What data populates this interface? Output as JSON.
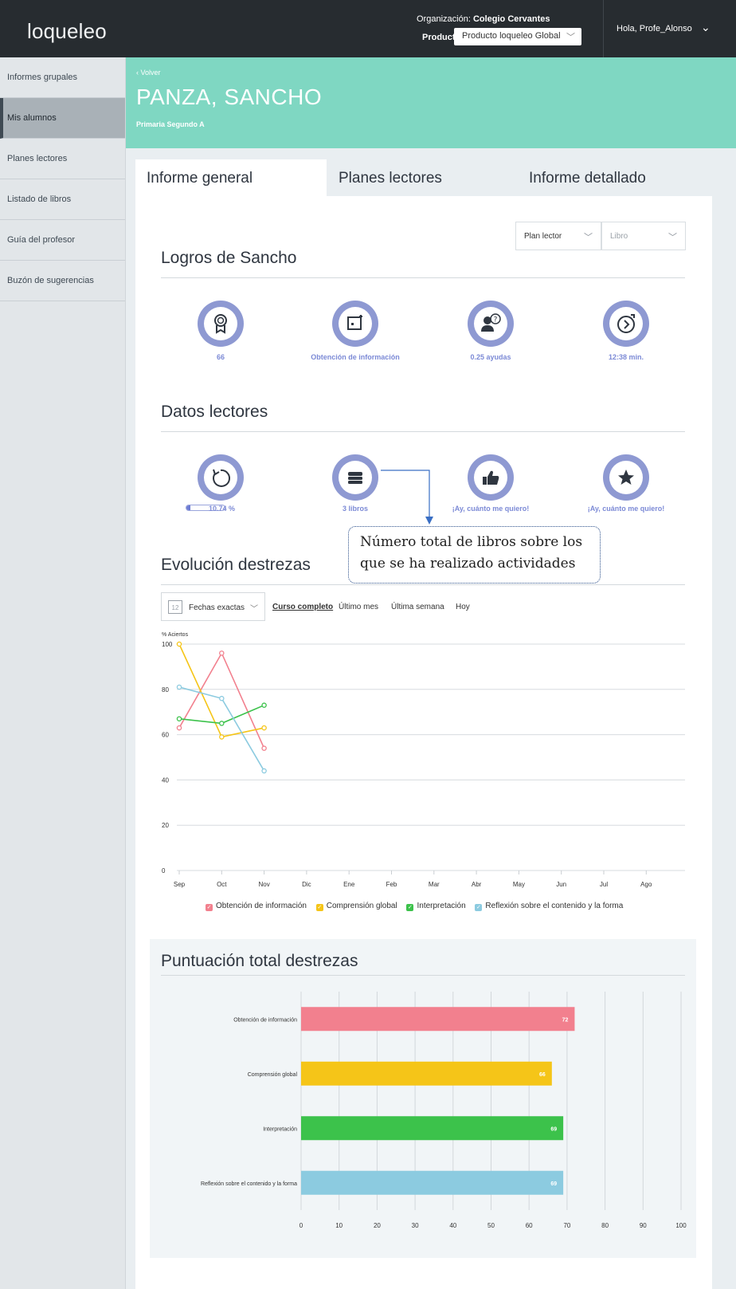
{
  "header": {
    "logo": "loqueleo",
    "org_label": "Organización:",
    "org_value": "Colegio Cervantes",
    "product_label": "Producto:",
    "product_value": "Producto loqueleo Global",
    "greeting": "Hola, Profe_Alonso"
  },
  "sidebar": {
    "items": [
      {
        "label": "Informes grupales"
      },
      {
        "label": "Mis alumnos"
      },
      {
        "label": "Planes lectores"
      },
      {
        "label": "Listado de libros"
      },
      {
        "label": "Guía del profesor"
      },
      {
        "label": "Buzón de sugerencias"
      }
    ],
    "active_index": 1
  },
  "student": {
    "back": "‹ Volver",
    "name": "PANZA, SANCHO",
    "group": "Primaria Segundo A"
  },
  "tabs": [
    {
      "label": "Informe general",
      "active": true
    },
    {
      "label": "Planes lectores",
      "active": false
    },
    {
      "label": "Informe detallado",
      "active": false
    }
  ],
  "filters": {
    "plan": "Plan lector",
    "book": "Libro"
  },
  "logros": {
    "title": "Logros de Sancho",
    "items": [
      {
        "icon": "medal-icon",
        "label": "66"
      },
      {
        "icon": "document-icon",
        "label": "Obtención de información"
      },
      {
        "icon": "help-user-icon",
        "label": "0.25 ayudas"
      },
      {
        "icon": "timer-icon",
        "label": "12:38 min."
      }
    ]
  },
  "datos": {
    "title": "Datos lectores",
    "progress_percent": 10.74,
    "items": [
      {
        "icon": "refresh-icon",
        "label": "10.74 %"
      },
      {
        "icon": "book-stack-icon",
        "label": "3 libros"
      },
      {
        "icon": "thumbs-up-icon",
        "label": "¡Ay, cuánto me quiero!"
      },
      {
        "icon": "star-icon",
        "label": "¡Ay, cuánto me quiero!"
      }
    ]
  },
  "callout": {
    "line1": "Número total de libros sobre los",
    "line2": "que se ha realizado actividades"
  },
  "evolucion": {
    "title": "Evolución destrezas",
    "date_filter": "Fechas exactas",
    "calendar_day": "12",
    "ranges": [
      {
        "label": "Curso completo",
        "active": true
      },
      {
        "label": "Último mes",
        "active": false
      },
      {
        "label": "Última semana",
        "active": false
      },
      {
        "label": "Hoy",
        "active": false
      }
    ]
  },
  "colors": {
    "obtencion": "#f2808e",
    "comprension": "#f5c518",
    "interpretacion": "#3cc24b",
    "reflexion": "#8ccbe0",
    "teal": "#7fd7c2",
    "badge": "#8e99d2"
  },
  "chart_data": [
    {
      "type": "line",
      "ylabel": "% Aciertos",
      "ylim": [
        0,
        100
      ],
      "yticks": [
        0,
        20,
        40,
        60,
        80,
        100
      ],
      "categories": [
        "Sep",
        "Oct",
        "Nov",
        "Dic",
        "Ene",
        "Feb",
        "Mar",
        "Abr",
        "May",
        "Jun",
        "Jul",
        "Ago"
      ],
      "series": [
        {
          "name": "Obtención de información",
          "values": [
            63,
            96,
            54
          ]
        },
        {
          "name": "Comprensión global",
          "values": [
            100,
            59,
            63
          ]
        },
        {
          "name": "Interpretación",
          "values": [
            67,
            65,
            73
          ]
        },
        {
          "name": "Reflexión sobre el contenido y la forma",
          "values": [
            81,
            76,
            44
          ]
        }
      ],
      "legend": "bottom",
      "grid": true
    },
    {
      "type": "bar",
      "title": "Puntuación total destrezas",
      "orientation": "horizontal",
      "categories": [
        "Obtención de información",
        "Comprensión global",
        "Interpretación",
        "Reflexión sobre el contenido y la forma"
      ],
      "values": [
        72,
        66,
        69,
        69
      ],
      "xlim": [
        0,
        100
      ],
      "xticks": [
        0,
        10,
        20,
        30,
        40,
        50,
        60,
        70,
        80,
        90,
        100
      ],
      "grid": true
    }
  ]
}
